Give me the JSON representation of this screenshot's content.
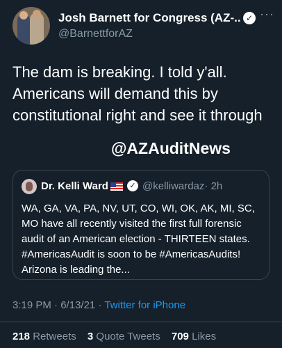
{
  "author": {
    "name": "Josh Barnett for Congress (AZ-...",
    "handle": "@BarnettforAZ",
    "more_label": "···"
  },
  "tweet": {
    "text": "The dam is breaking. I told y'all. Americans will demand this by constitutional right and see it through"
  },
  "overlay_text": "@AZAuditNews",
  "quoted": {
    "name": "Dr. Kelli Ward",
    "handle": "@kelliwardaz",
    "time": "· 2h",
    "text": "WA, GA, VA, PA, NV, UT, CO, WI, OK, AK, MI, SC, MO have all recently visited the first full forensic audit of an American election - THIRTEEN states. #AmericasAudit is soon to be #AmericasAudits! Arizona  is leading the..."
  },
  "meta": {
    "time": "3:19 PM",
    "date": "6/13/21",
    "separator": " · ",
    "source": "Twitter for iPhone"
  },
  "stats": {
    "retweets_count": "218",
    "retweets_label": "Retweets",
    "quotes_count": "3",
    "quotes_label": "Quote Tweets",
    "likes_count": "709",
    "likes_label": "Likes"
  },
  "colors": {
    "background": "#15202b",
    "secondary_text": "#8899a6",
    "link": "#1d9bf0",
    "border": "#38444d"
  }
}
